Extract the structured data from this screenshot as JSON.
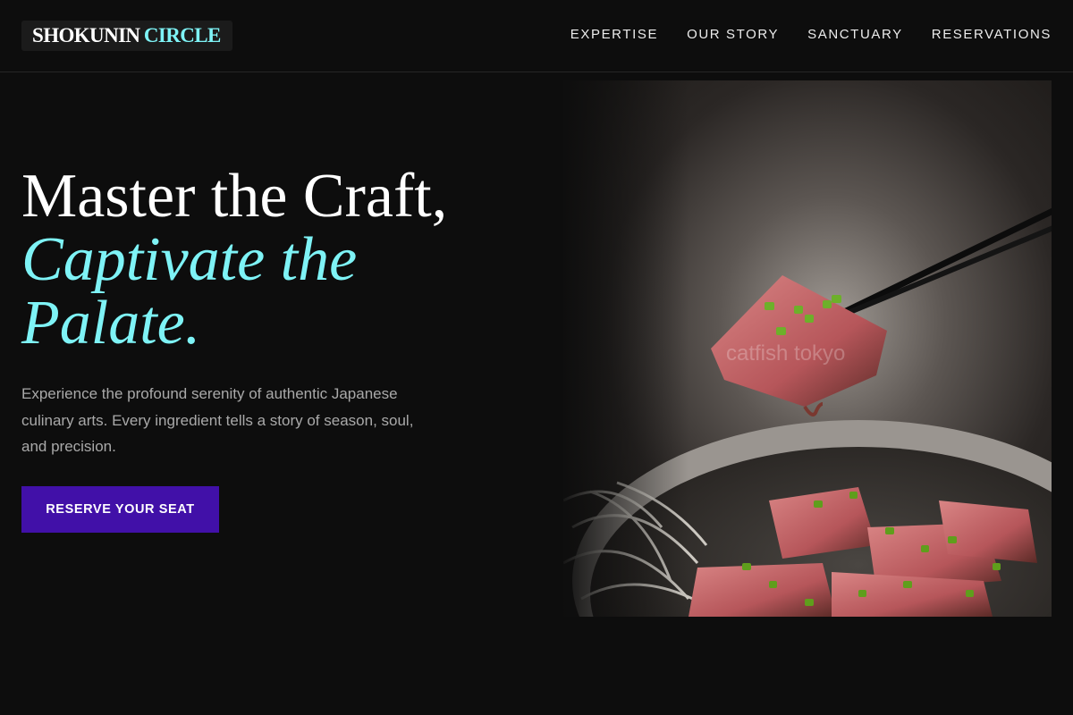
{
  "brand": {
    "name_part1": "SHOKUNIN",
    "name_part2": "CIRCLE"
  },
  "nav": {
    "links": [
      {
        "label": "EXPERTISE"
      },
      {
        "label": "OUR STORY"
      },
      {
        "label": "SANCTUARY"
      },
      {
        "label": "RESERVATIONS"
      }
    ]
  },
  "hero": {
    "title_line1": "Master the Craft,",
    "title_line2": "Captivate the Palate.",
    "description": "Experience the profound serenity of authentic Japanese culinary arts. Every ingredient tells a story of season, soul, and precision.",
    "cta_label": "RESERVE YOUR SEAT",
    "image_watermark": "catfish tokyo"
  },
  "colors": {
    "background": "#0d0d0d",
    "accent_cyan": "#7ef3f6",
    "cta_purple": "#4110a8",
    "text_muted": "#a9a9a9"
  }
}
